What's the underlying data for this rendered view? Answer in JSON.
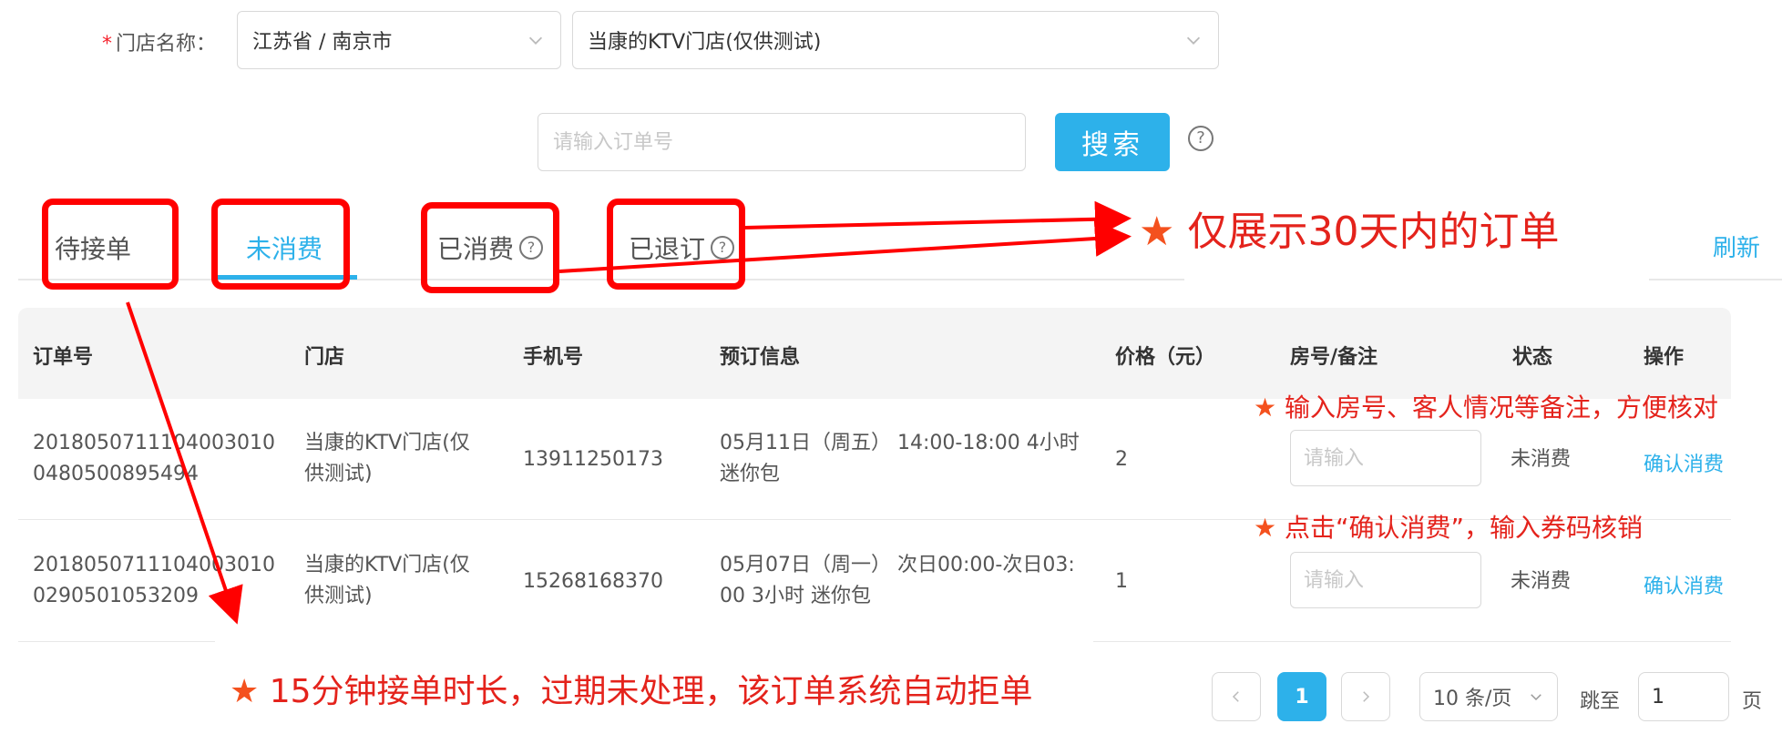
{
  "store": {
    "label": "门店名称：",
    "required_mark": "*",
    "region_value": "江苏省 / 南京市",
    "store_value": "当康的KTV门店(仅供测试)"
  },
  "search": {
    "placeholder": "请输入订单号",
    "button_label": "搜索",
    "help": "?"
  },
  "tabs": [
    {
      "label": "待接单",
      "active": false,
      "has_help": false
    },
    {
      "label": "未消费",
      "active": true,
      "has_help": false
    },
    {
      "label": "已消费",
      "active": false,
      "has_help": true
    },
    {
      "label": "已退订",
      "active": false,
      "has_help": true
    }
  ],
  "refresh_label": "刷新",
  "table": {
    "headers": [
      "订单号",
      "门店",
      "手机号",
      "预订信息",
      "价格（元）",
      "房号/备注",
      "状态",
      "操作"
    ],
    "rows": [
      {
        "order_no_line1": "2018050711104003010",
        "order_no_line2": "0480500895494",
        "store_line1": "当康的KTV门店(仅",
        "store_line2": "供测试)",
        "phone": "13911250173",
        "booking_line1": "05月11日（周五） 14:00-18:00 4小时",
        "booking_line2": "迷你包",
        "price": "2",
        "room_placeholder": "请输入",
        "status": "未消费",
        "action": "确认消费"
      },
      {
        "order_no_line1": "2018050711104003010",
        "order_no_line2": "0290501053209",
        "store_line1": "当康的KTV门店(仅",
        "store_line2": "供测试)",
        "phone": "15268168370",
        "booking_line1": "05月07日（周一） 次日00:00-次日03:",
        "booking_line2": "00 3小时 迷你包",
        "price": "1",
        "room_placeholder": "请输入",
        "status": "未消费",
        "action": "确认消费"
      }
    ]
  },
  "pagination": {
    "current_page": "1",
    "page_size": "10 条/页",
    "jump_label": "跳至",
    "jump_value": "1",
    "page_suffix": "页"
  },
  "annotations": {
    "star": "★",
    "tip_30days": "仅展示30天内的订单",
    "tip_room": "输入房号、客人情况等备注，方便核对",
    "tip_confirm": "点击“确认消费”，输入券码核销",
    "tip_15min": "15分钟接单时长，过期未处理，该订单系统自动拒单"
  },
  "colors": {
    "accent": "#2db1ea",
    "annotation_red": "#ff0000",
    "annotation_text": "#e4231c"
  }
}
